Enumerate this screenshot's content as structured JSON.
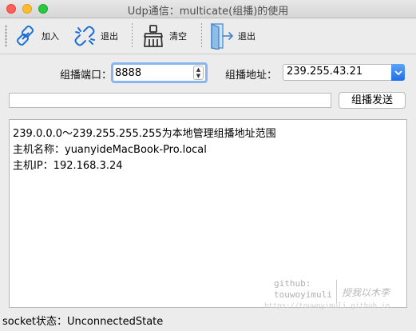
{
  "window": {
    "title": "Udp通信：multicate(组播)的使用"
  },
  "toolbar": {
    "join_label": "加入",
    "exit1_label": "退出",
    "clear_label": "清空",
    "exit2_label": "退出"
  },
  "form": {
    "port_label": "组播端口：",
    "port_value": "8888",
    "addr_label": "组播地址：",
    "addr_value": "239.255.43.21",
    "message_value": "",
    "send_label": "组播发送"
  },
  "log": {
    "lines": [
      "239.0.0.0～239.255.255.255为本地管理组播地址范围",
      "主机名称：yuanyideMacBook-Pro.local",
      "主机IP：192.168.3.24"
    ]
  },
  "watermark": {
    "line1": "github:",
    "line2": "touwoyimuli",
    "motto": "授我以木李",
    "url": "https://touwoyimuli.github.io"
  },
  "status": {
    "text": "socket状态：UnconnectedState"
  },
  "colors": {
    "accent": "#1f6ee8",
    "focus": "#8ab6ee"
  }
}
